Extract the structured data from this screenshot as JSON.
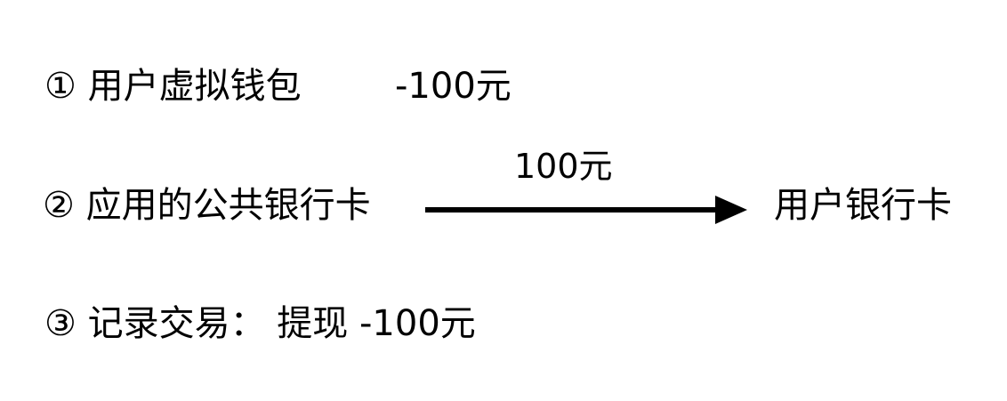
{
  "steps": {
    "step1": {
      "text": "① 用户虚拟钱包",
      "amount": "-100元"
    },
    "step2": {
      "text": "② 应用的公共银行卡"
    },
    "step3": {
      "text": "③ 记录交易：  提现 -100元"
    }
  },
  "transfer": {
    "label": "100元",
    "target": "用户银行卡"
  },
  "colors": {
    "text": "#000000",
    "arrow": "#000000",
    "background": "#ffffff"
  }
}
